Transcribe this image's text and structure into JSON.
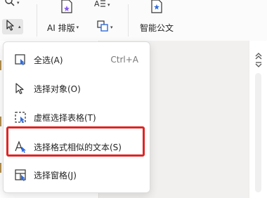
{
  "toolbar": {
    "ai_layout_label": "AI 排版",
    "smart_doc_label": "智能公文"
  },
  "menu": {
    "items": [
      {
        "label": "全选(A)",
        "shortcut": "Ctrl+A",
        "icon": "select-all-icon"
      },
      {
        "label": "选择对象(O)",
        "icon": "select-object-icon"
      },
      {
        "label": "虚框选择表格(T)",
        "icon": "dashed-table-select-icon"
      },
      {
        "label": "选择格式相似的文本(S)",
        "icon": "select-similar-text-icon"
      },
      {
        "label": "选择窗格(J)",
        "icon": "selection-pane-icon"
      }
    ]
  },
  "colors": {
    "accent": "#2f6bdc",
    "highlight": "#e02424"
  }
}
